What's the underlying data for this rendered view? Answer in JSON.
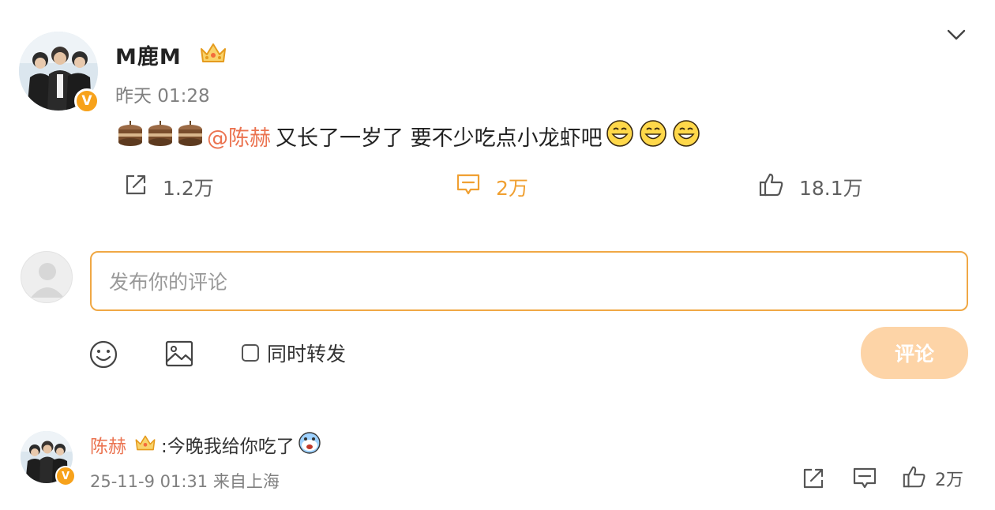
{
  "post": {
    "username": "M鹿M",
    "timestamp": "昨天 01:28",
    "mention": "@陈赫",
    "text": "又长了一岁了 要不少吃点小龙虾吧",
    "actions": {
      "repost_count": "1.2万",
      "comment_count": "2万",
      "like_count": "18.1万"
    }
  },
  "composer": {
    "placeholder": "发布你的评论",
    "forward_label": "同时转发",
    "submit_label": "评论"
  },
  "reply": {
    "username": "陈赫",
    "text": ":今晚我给你吃了",
    "meta": "25-11-9 01:31 来自上海",
    "like_count": "2万"
  },
  "icons": {
    "chevron": "chevron-down-icon",
    "repost": "repost-icon",
    "comment": "comment-icon",
    "like": "thumbs-up-icon",
    "emoji": "smiley-icon",
    "image": "image-icon",
    "crown": "crown-icon",
    "verified": "verified-v-icon"
  },
  "colors": {
    "accent": "#eb7350",
    "comment_active": "#f0a032",
    "input_border": "#f0a845",
    "submit_disabled": "#fdd4a7",
    "verified_badge": "#f7a21b"
  }
}
